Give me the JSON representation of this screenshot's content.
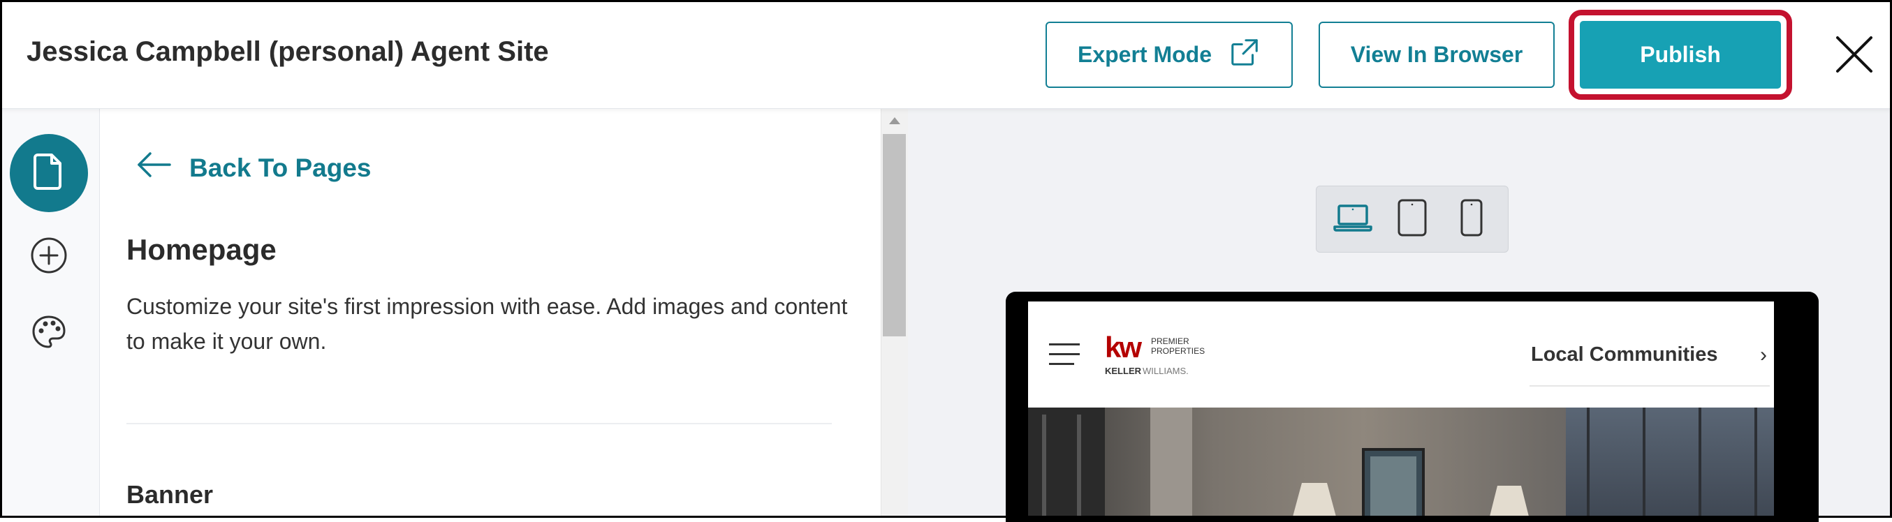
{
  "header": {
    "site_title": "Jessica Campbell (personal) Agent Site",
    "expert_mode_label": "Expert Mode",
    "view_in_browser_label": "View In Browser",
    "publish_label": "Publish"
  },
  "rail": {
    "items": [
      {
        "icon": "page-icon",
        "active": true
      },
      {
        "icon": "plus-circle-icon",
        "active": false
      },
      {
        "icon": "palette-icon",
        "active": false
      }
    ]
  },
  "panel": {
    "back_label": "Back To Pages",
    "page_title": "Homepage",
    "page_description": "Customize your site's first impression with ease. Add images and content to make it your own.",
    "section_title": "Banner"
  },
  "preview": {
    "devices": [
      "laptop-icon",
      "tablet-icon",
      "phone-icon"
    ],
    "selected_device": "laptop-icon",
    "site": {
      "logo_mark": "kw",
      "logo_line1": "PREMIER",
      "logo_line2": "PROPERTIES",
      "logo_brand_a": "KELLER",
      "logo_brand_b": "WILLIAMS.",
      "nav_item": "Local Communities",
      "nav_chevron": "›"
    }
  },
  "colors": {
    "accent": "#127f94",
    "publish_bg": "#17a1b4",
    "highlight_ring": "#c4122f",
    "logo_red": "#b40101"
  }
}
